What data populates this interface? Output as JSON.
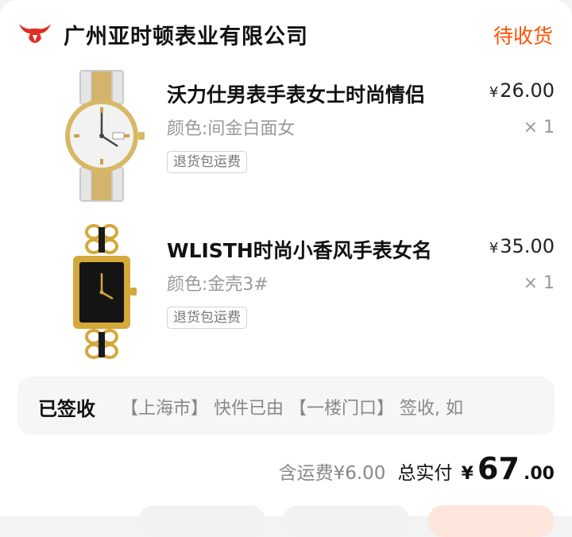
{
  "shop": {
    "name": "广州亚时顿表业有限公司",
    "logo_icon": "bull-logo-icon",
    "accent_color": "#e02e24"
  },
  "order": {
    "status": "待收货",
    "status_color": "#ff5000"
  },
  "items": [
    {
      "title": "沃力仕男表手表女士时尚情侣",
      "variant": "颜色:间金白面女",
      "tag": "退货包运费",
      "price_symbol": "¥",
      "price": "26.00",
      "quantity": "× 1",
      "thumbnail_icon": "watch-two-tone-thumbnail"
    },
    {
      "title": "WLISTH时尚小香风手表女名",
      "variant": "颜色:金壳3#",
      "tag": "退货包运费",
      "price_symbol": "¥",
      "price": "35.00",
      "quantity": "× 1",
      "thumbnail_icon": "watch-chain-thumbnail"
    }
  ],
  "logistics": {
    "status": "已签收",
    "text": "【上海市】 快件已由 【一楼门口】 签收, 如"
  },
  "totals": {
    "shipping": "含运费¥6.00",
    "label": "总实付",
    "symbol": "¥",
    "integer": "67",
    "decimal": ".00"
  }
}
